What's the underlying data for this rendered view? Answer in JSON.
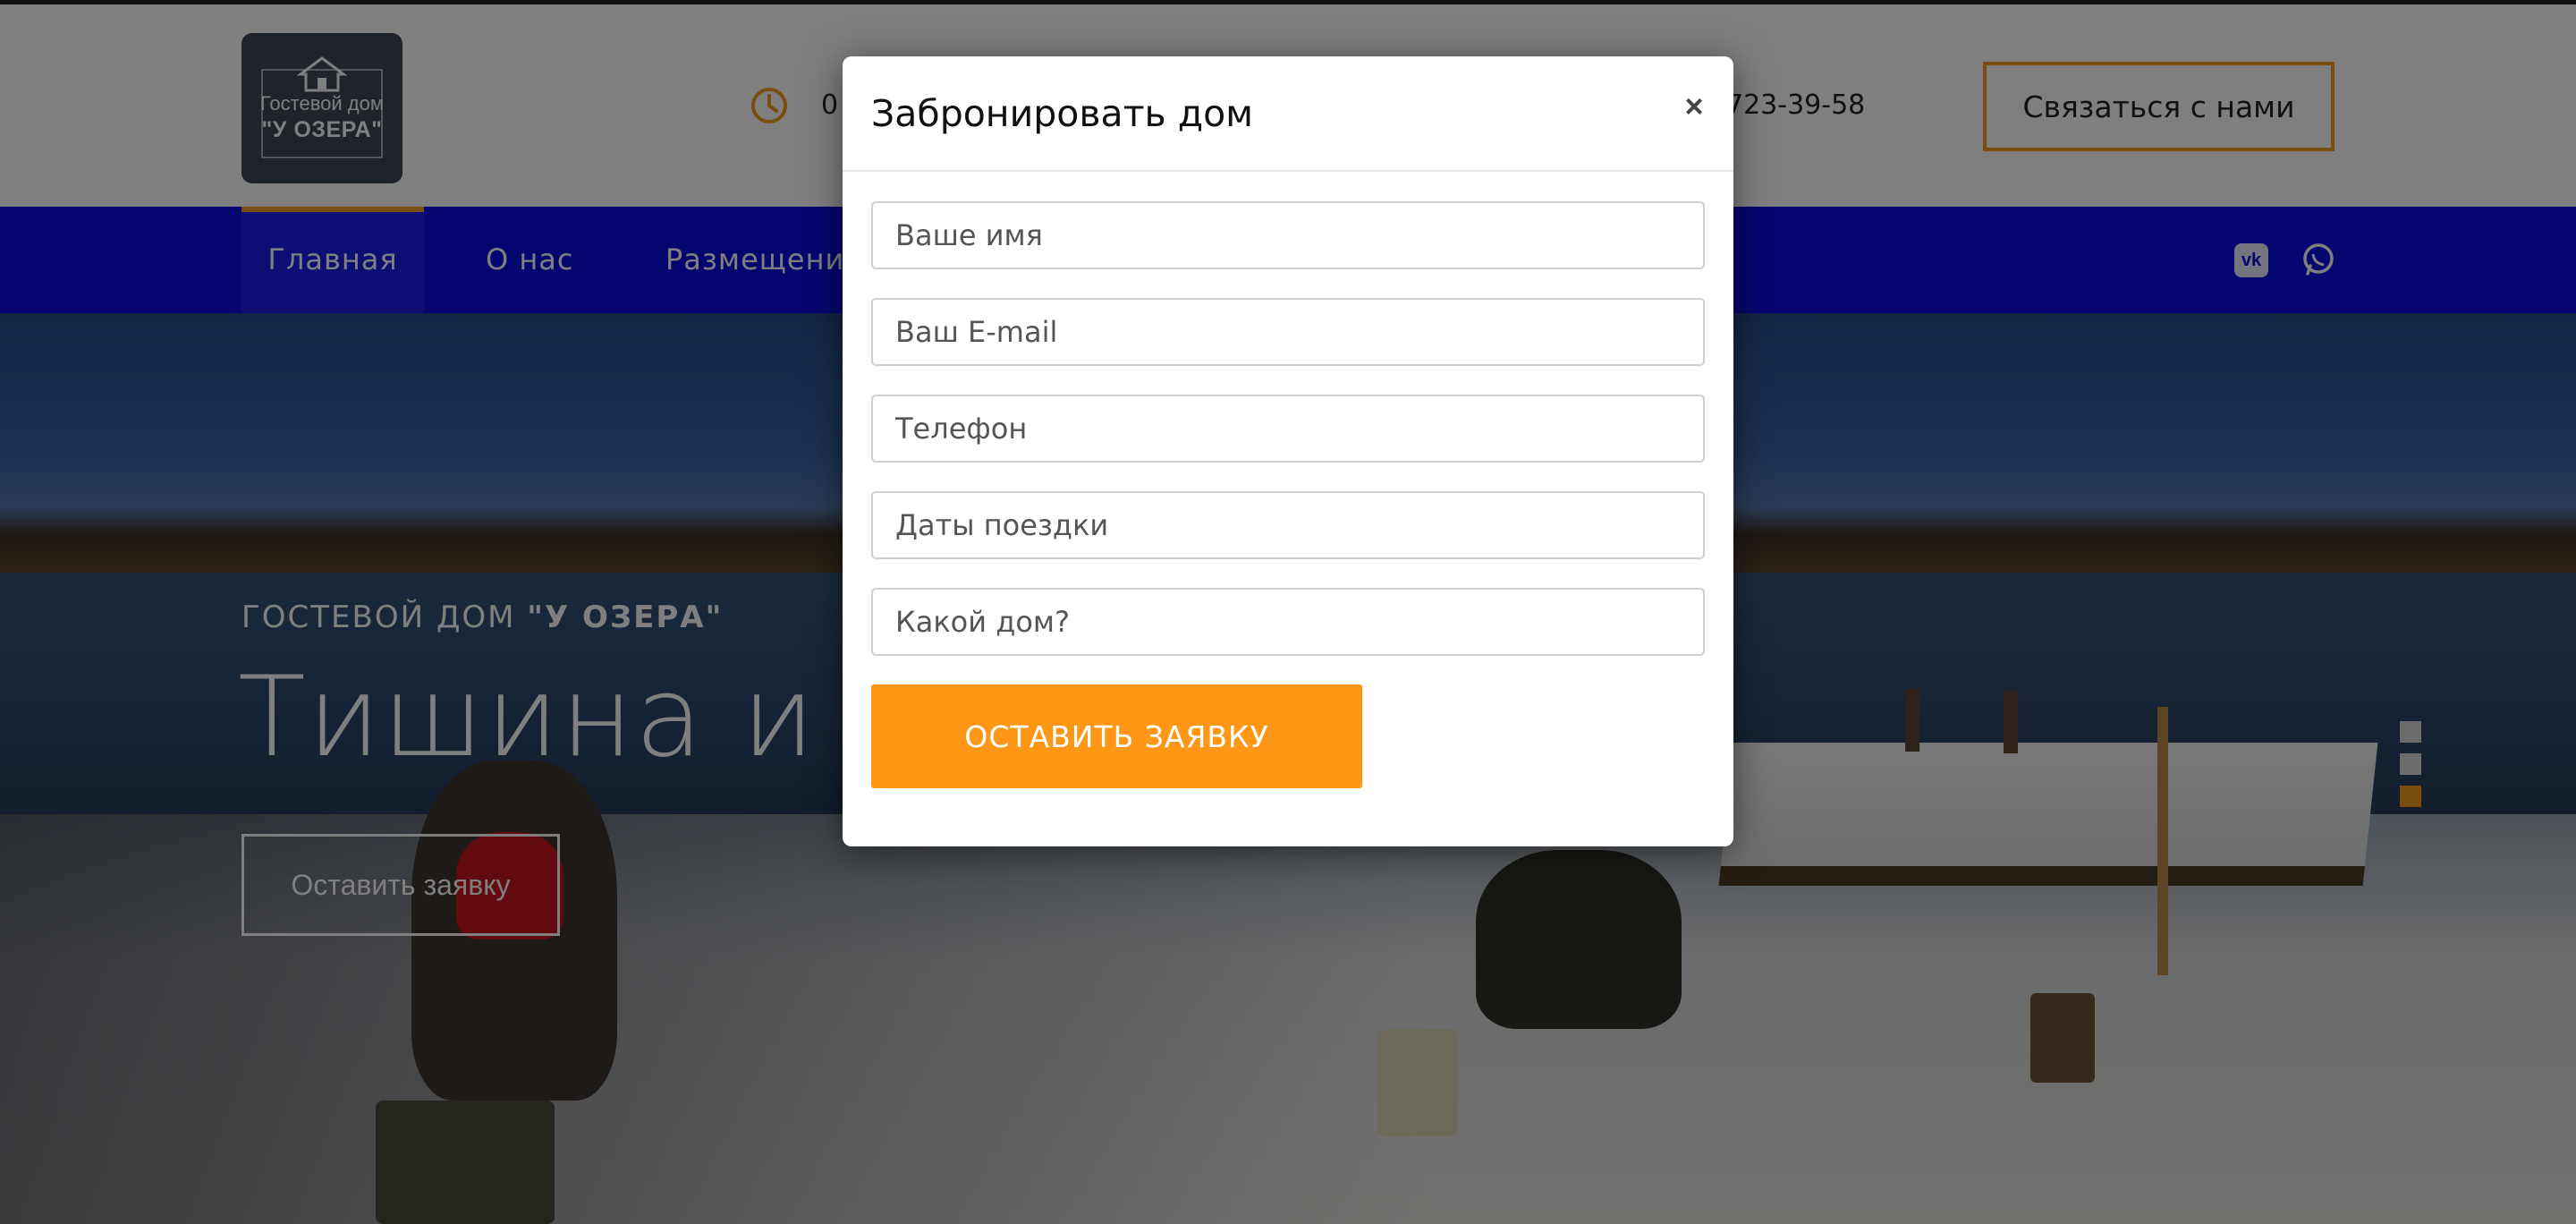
{
  "header": {
    "logo": {
      "line1": "Гостевой дом",
      "line2": "\"У ОЗЕРА\""
    },
    "working_hours": "0",
    "phone": "723-39-58",
    "contact_button": "Связаться с нами"
  },
  "nav": {
    "items": [
      {
        "label": "Главная",
        "active": true
      },
      {
        "label": "О нас"
      },
      {
        "label": "Размещение"
      }
    ],
    "social": [
      "vk-icon",
      "whatsapp-icon"
    ]
  },
  "hero": {
    "subtitle_prefix": "ГОСТЕВОЙ ДОМ ",
    "subtitle_bold": "\"У ОЗЕРА\"",
    "title": "Тишина и",
    "button": "Оставить заявку",
    "slides_count": 3,
    "active_slide": 3
  },
  "modal": {
    "title": "Забронировать дом",
    "close_symbol": "×",
    "fields": {
      "name": "Ваше имя",
      "email": "Ваш E-mail",
      "phone": "Телефон",
      "dates": "Даты поездки",
      "house": "Какой дом?"
    },
    "submit": "ОСТАВИТЬ ЗАЯВКУ"
  },
  "colors": {
    "accent": "#fd9715",
    "nav": "#0a0be0",
    "overlay": "rgba(0,0,0,0.5)"
  }
}
